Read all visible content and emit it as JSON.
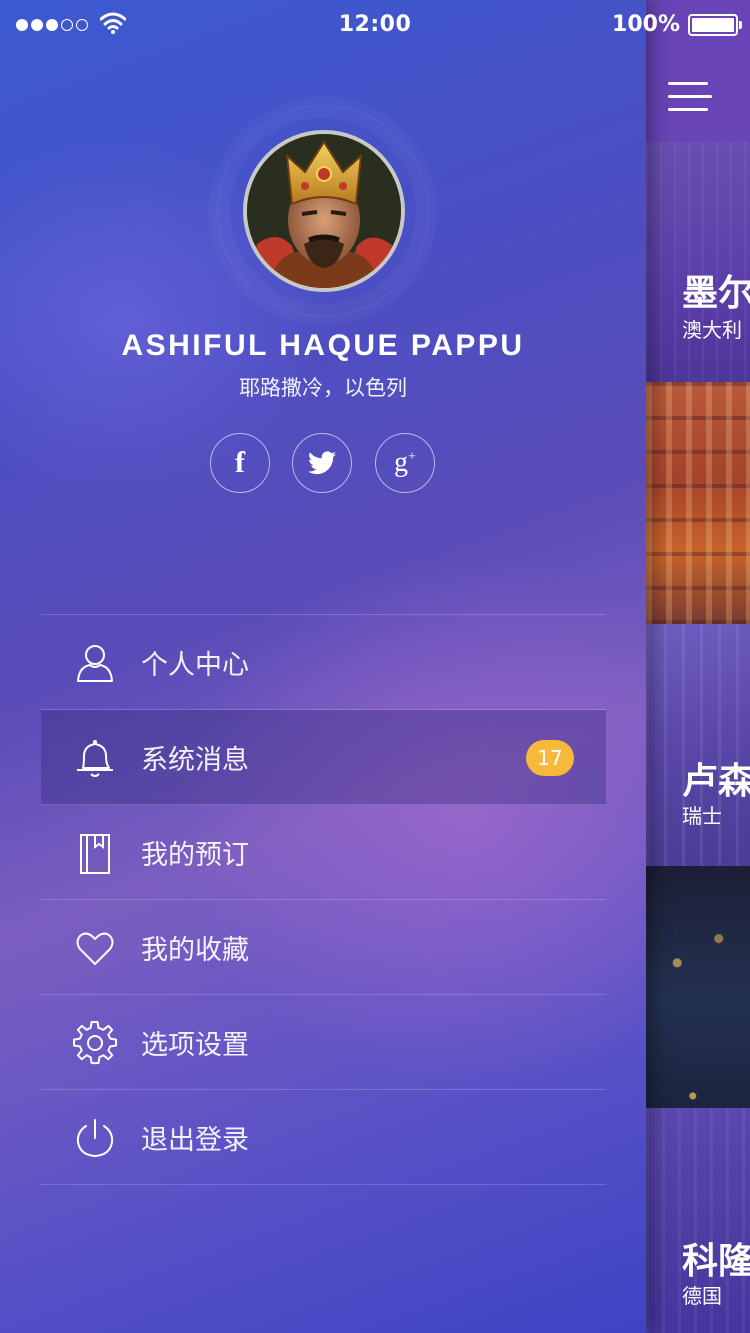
{
  "status_bar": {
    "time": "12:00",
    "battery": "100%"
  },
  "profile": {
    "name": "ASHIFUL HAQUE PAPPU",
    "location": "耶路撒冷，以色列"
  },
  "social": {
    "facebook_glyph": "f",
    "twitter_icon": "twitter-icon",
    "googleplus_glyph": "g",
    "googleplus_sup": "+"
  },
  "menu": {
    "items": [
      {
        "label": "个人中心",
        "icon": "user-icon"
      },
      {
        "label": "系统消息",
        "icon": "bell-icon",
        "badge": "17",
        "active": true
      },
      {
        "label": "我的预订",
        "icon": "book-icon"
      },
      {
        "label": "我的收藏",
        "icon": "heart-icon"
      },
      {
        "label": "选项设置",
        "icon": "gear-icon"
      },
      {
        "label": "退出登录",
        "icon": "power-icon"
      }
    ]
  },
  "destinations": [
    {
      "title": "墨尔",
      "subtitle": "澳大利"
    },
    {
      "title": "",
      "subtitle": ""
    },
    {
      "title": "卢森",
      "subtitle": "瑞士"
    },
    {
      "title": "",
      "subtitle": ""
    },
    {
      "title": "科隆",
      "subtitle": "德国"
    }
  ],
  "colors": {
    "badge": "#f6b93a",
    "drawer_top": "#3c5ad0",
    "drawer_mid": "#7b5ec0",
    "drawer_bottom": "#3d44c4"
  }
}
